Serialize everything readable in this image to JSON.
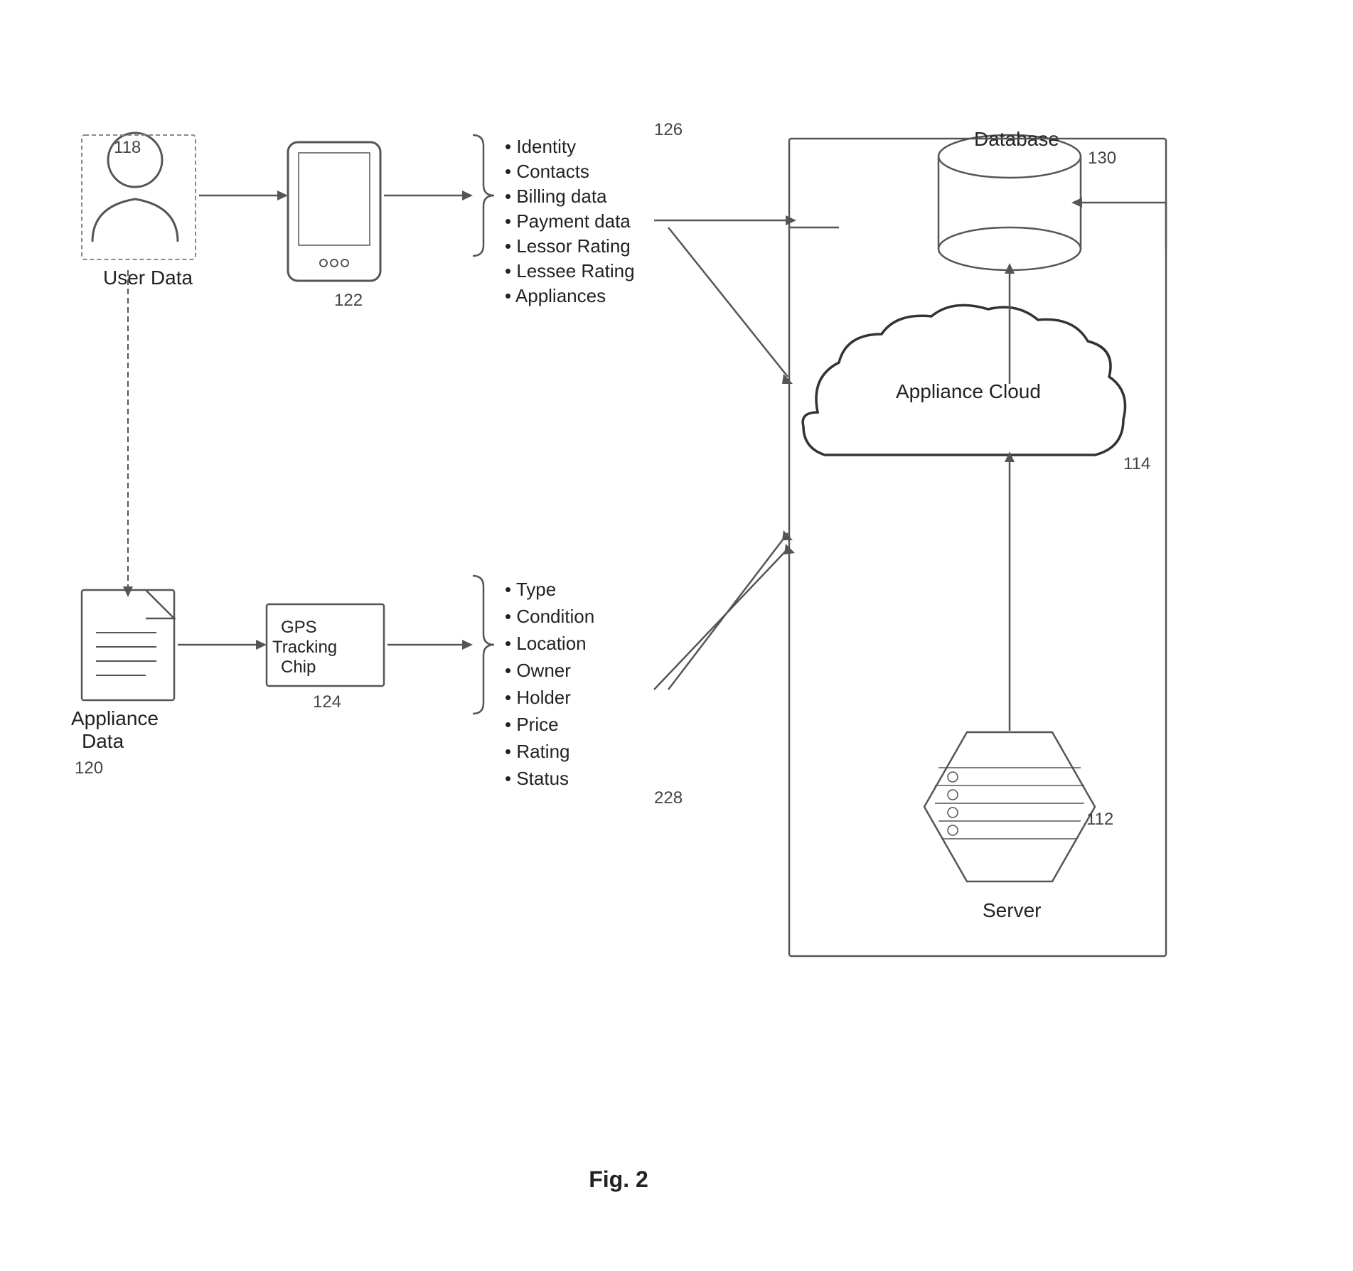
{
  "diagram": {
    "title": "Fig. 2",
    "labels": {
      "user_data": "User Data",
      "appliance_data": "Appliance Data",
      "gps_chip": "GPS Tracking Chip",
      "database": "Database",
      "appliance_cloud": "Appliance Cloud",
      "server": "Server",
      "ref_118": "118",
      "ref_122": "122",
      "ref_120": "120",
      "ref_124": "124",
      "ref_126": "126",
      "ref_228": "228",
      "ref_114": "114",
      "ref_112": "112",
      "ref_130": "130"
    },
    "user_data_items": [
      "Identity",
      "Contacts",
      "Billing data",
      "Payment data",
      "Lessor Rating",
      "Lessee Rating",
      "Appliances"
    ],
    "appliance_data_items": [
      "Type",
      "Condition",
      "Location",
      "Owner",
      "Holder",
      "Price",
      "Rating",
      "Status"
    ]
  }
}
